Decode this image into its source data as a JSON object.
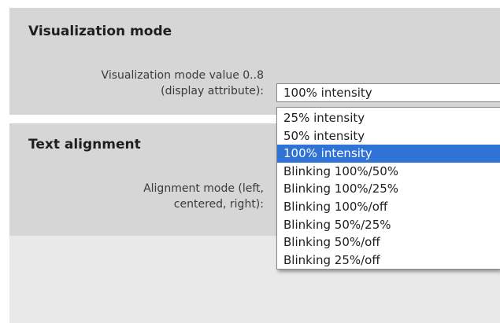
{
  "visualization": {
    "title": "Visualization mode",
    "label_line1": "Visualization mode value 0..8",
    "label_line2": "(display attribute):",
    "selected_value": "100% intensity",
    "options": [
      "25% intensity",
      "50% intensity",
      "100% intensity",
      "Blinking 100%/50%",
      "Blinking 100%/25%",
      "Blinking 100%/off",
      "Blinking 50%/25%",
      "Blinking 50%/off",
      "Blinking 25%/off"
    ],
    "highlighted_index": 2
  },
  "alignment": {
    "title": "Text alignment",
    "label_line1": "Alignment mode (left,",
    "label_line2": "centered, right):"
  },
  "colors": {
    "panel_bg": "#d6d6d6",
    "empty_area_bg": "#e9e9e9",
    "selection_highlight": "#3073d6"
  }
}
